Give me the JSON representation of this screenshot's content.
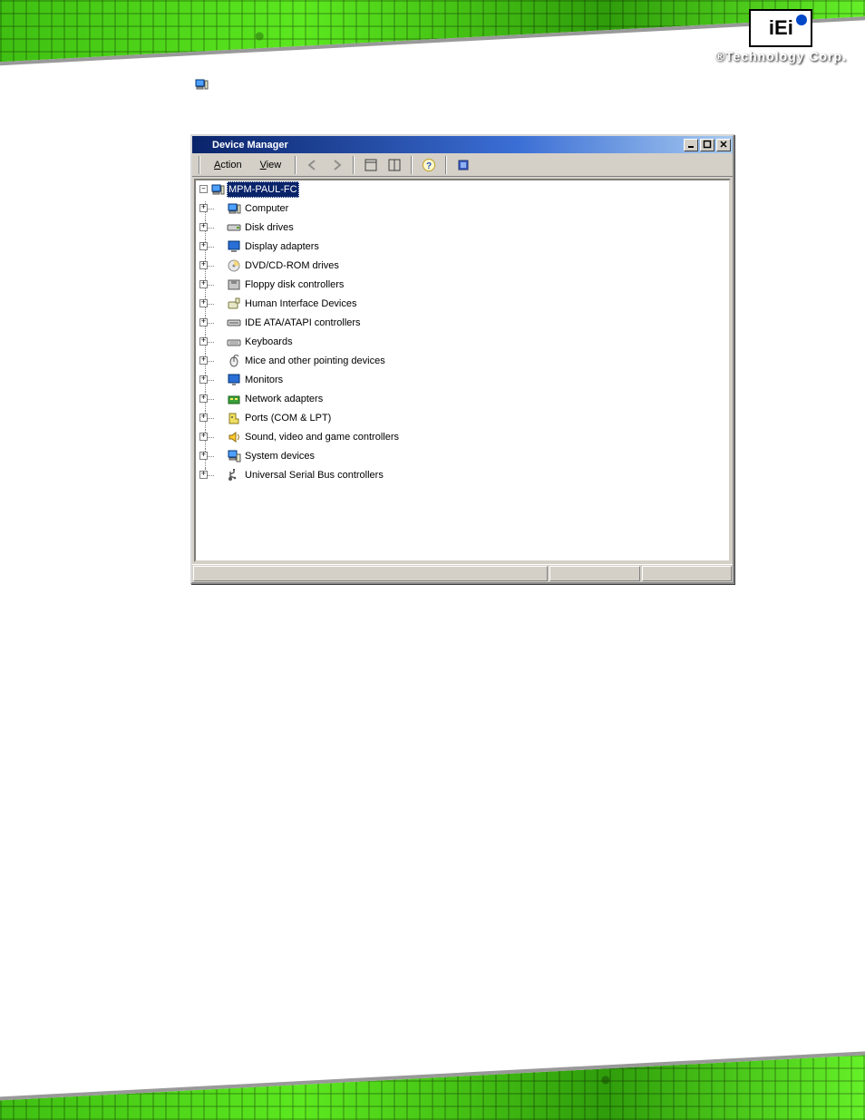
{
  "brand": {
    "logo_text": "iEi",
    "tagline": "®Technology Corp."
  },
  "window": {
    "title": "Device Manager",
    "menus": {
      "action": "Action",
      "view": "View"
    },
    "toolbar": {
      "back": "Back",
      "forward": "Forward",
      "properties1": "Show window",
      "properties2": "Windows layout",
      "help": "Help",
      "refresh": "Refresh"
    },
    "win_controls": {
      "min": "_",
      "max": "□",
      "close": "×"
    }
  },
  "tree": {
    "root": {
      "label": "MPM-PAUL-FC",
      "expander": "–"
    },
    "children": [
      {
        "key": "computer",
        "label": "Computer",
        "icon": "computer-icon"
      },
      {
        "key": "disk",
        "label": "Disk drives",
        "icon": "disk-icon"
      },
      {
        "key": "display",
        "label": "Display adapters",
        "icon": "display-icon"
      },
      {
        "key": "dvd",
        "label": "DVD/CD-ROM drives",
        "icon": "cdrom-icon"
      },
      {
        "key": "floppy",
        "label": "Floppy disk controllers",
        "icon": "floppy-icon"
      },
      {
        "key": "hid",
        "label": "Human Interface Devices",
        "icon": "hid-icon"
      },
      {
        "key": "ide",
        "label": "IDE ATA/ATAPI controllers",
        "icon": "ide-icon"
      },
      {
        "key": "keyboard",
        "label": "Keyboards",
        "icon": "keyboard-icon"
      },
      {
        "key": "mice",
        "label": "Mice and other pointing devices",
        "icon": "mouse-icon"
      },
      {
        "key": "monitors",
        "label": "Monitors",
        "icon": "monitor-icon"
      },
      {
        "key": "network",
        "label": "Network adapters",
        "icon": "network-icon"
      },
      {
        "key": "ports",
        "label": "Ports (COM & LPT)",
        "icon": "ports-icon"
      },
      {
        "key": "sound",
        "label": "Sound, video and game controllers",
        "icon": "sound-icon"
      },
      {
        "key": "system",
        "label": "System devices",
        "icon": "system-icon"
      },
      {
        "key": "usb",
        "label": "Universal Serial Bus controllers",
        "icon": "usb-icon"
      }
    ],
    "child_expander": "+"
  }
}
